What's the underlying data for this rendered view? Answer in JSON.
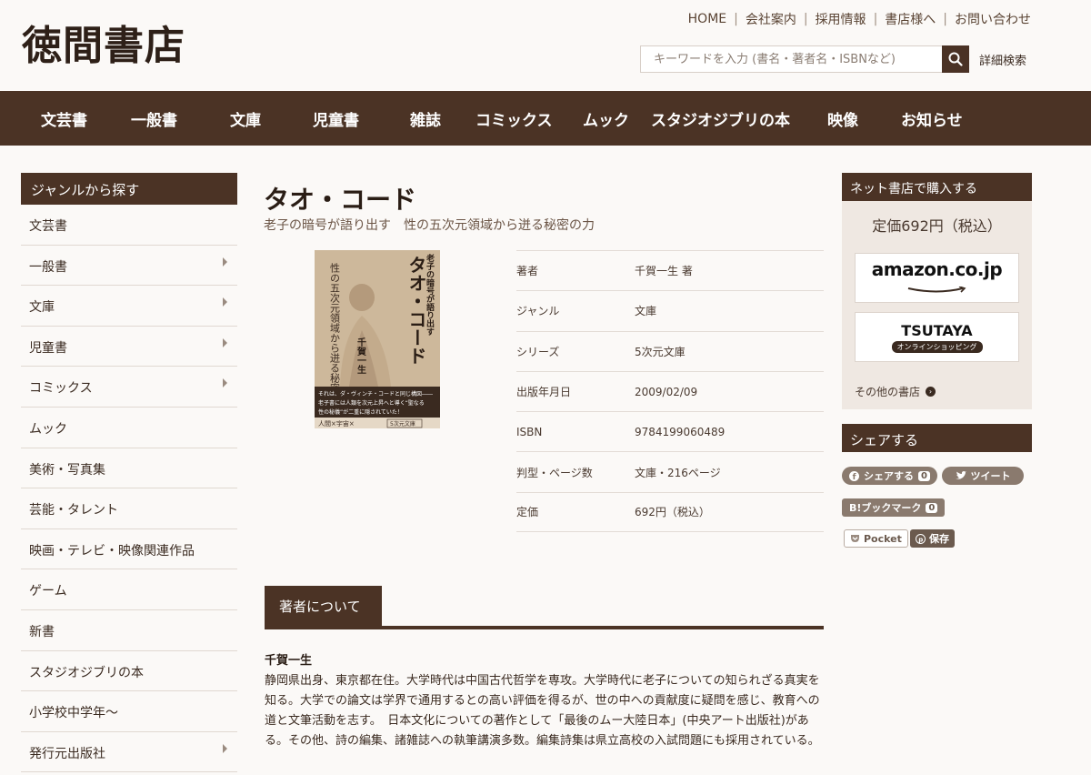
{
  "header": {
    "logo": "徳間書店",
    "links": [
      "HOME",
      "会社案内",
      "採用情報",
      "書店様へ",
      "お問い合わせ"
    ],
    "search_placeholder": "キーワードを入力 (書名・著者名・ISBNなど)",
    "advanced_search": "詳細検索"
  },
  "nav": [
    "文芸書",
    "一般書",
    "文庫",
    "児童書",
    "雑誌",
    "コミックス",
    "ムック",
    "スタジオジブリの本",
    "映像",
    "お知らせ"
  ],
  "sidebar": {
    "heading": "ジャンルから探す",
    "items": [
      {
        "label": "文芸書",
        "has_sub": false
      },
      {
        "label": "一般書",
        "has_sub": true
      },
      {
        "label": "文庫",
        "has_sub": true
      },
      {
        "label": "児童書",
        "has_sub": true
      },
      {
        "label": "コミックス",
        "has_sub": true
      },
      {
        "label": "ムック",
        "has_sub": false
      },
      {
        "label": "美術・写真集",
        "has_sub": false
      },
      {
        "label": "芸能・タレント",
        "has_sub": false
      },
      {
        "label": "映画・テレビ・映像関連作品",
        "has_sub": false
      },
      {
        "label": "ゲーム",
        "has_sub": false
      },
      {
        "label": "新書",
        "has_sub": false
      },
      {
        "label": "スタジオジブリの本",
        "has_sub": false
      },
      {
        "label": "小学校中学年～",
        "has_sub": false
      },
      {
        "label": "発行元出版社",
        "has_sub": true
      }
    ]
  },
  "book": {
    "title": "タオ・コード",
    "subtitle": "老子の暗号が語り出す　性の五次元領域から迸る秘密の力",
    "cover": {
      "title": "タオ・コード",
      "top_text": "老子の暗号が語り出す",
      "side_text": "性の五次元領域から迸る秘密の力",
      "author": "千賀一生",
      "band_line1": "それは、ダ・ヴィンチ・コードと同じ構図――",
      "band_line2": "老子書には人類を次元上昇へと導く“聖なる",
      "band_line3": "性の秘儀”が二重に隠されていた！",
      "footer": "人間×宇宙×",
      "label": "5次元文庫"
    },
    "details": [
      {
        "key": "著者",
        "value": "千賀一生 著"
      },
      {
        "key": "ジャンル",
        "value": "文庫"
      },
      {
        "key": "シリーズ",
        "value": "5次元文庫"
      },
      {
        "key": "出版年月日",
        "value": "2009/02/09"
      },
      {
        "key": "ISBN",
        "value": "9784199060489"
      },
      {
        "key": "判型・ページ数",
        "value": "文庫・216ページ"
      },
      {
        "key": "定価",
        "value": "692円（税込）"
      }
    ]
  },
  "about": {
    "tab": "著者について",
    "name": "千賀一生",
    "bio": "静岡県出身、東京都在住。大学時代は中国古代哲学を専攻。大学時代に老子についての知られざる真実を知る。大学での論文は学界で通用するとの高い評価を得るが、世の中への貢献度に疑問を感じ、教育への道と文筆活動を志す。　日本文化についての著作として「最後のムー大陸日本」(中央アート出版社)がある。その他、詩の編集、諸雑誌への執筆講演多数。編集詩集は県立高校の入試問題にも採用されている。"
  },
  "buy": {
    "heading": "ネット書店で購入する",
    "price": "定価692円（税込）",
    "amazon": "amazon.co.jp",
    "tsutaya": "TSUTAYA",
    "tsutaya_sub": "オンラインショッピング",
    "others": "その他の書店"
  },
  "share": {
    "heading": "シェアする",
    "facebook": "シェアする",
    "facebook_count": "0",
    "twitter": "ツイート",
    "hatena": "B!ブックマーク",
    "hatena_count": "0",
    "pocket": "Pocket",
    "pinterest": "保存"
  },
  "colors": {
    "brand": "#4b3325",
    "background": "#fbf9f7"
  }
}
